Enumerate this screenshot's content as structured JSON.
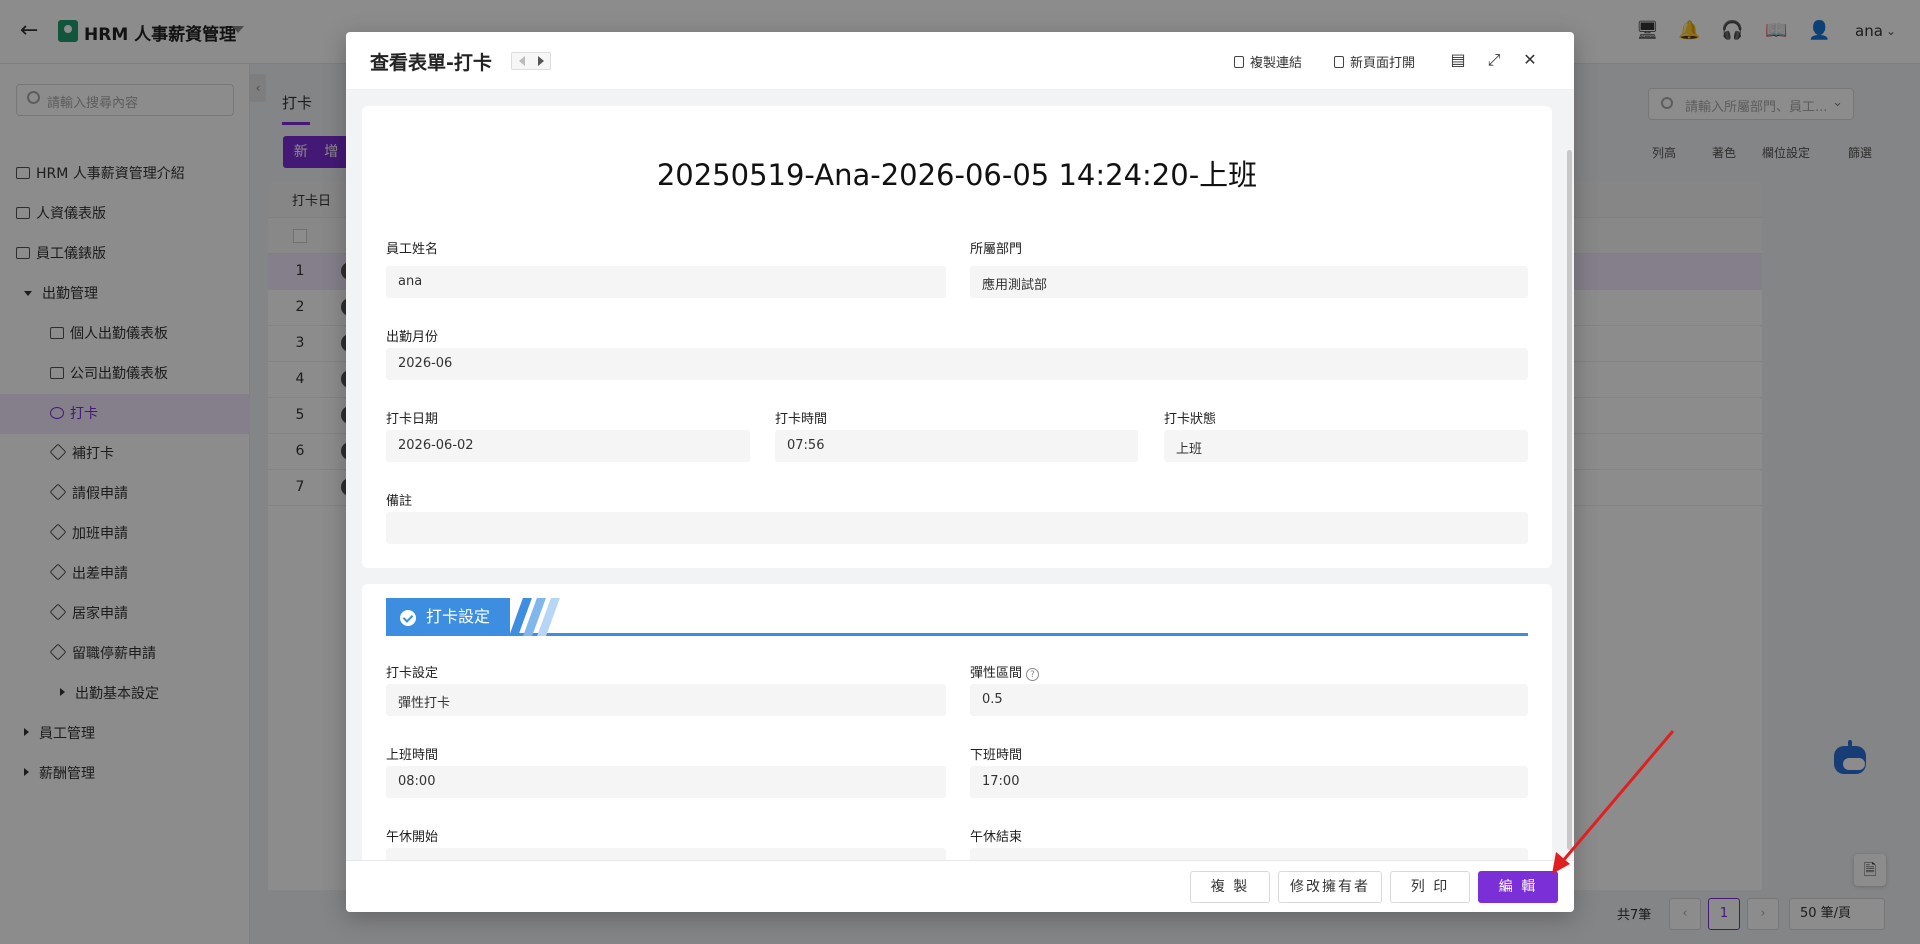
{
  "topbar": {
    "app_title": "HRM 人事薪資管理",
    "user": "ana",
    "icons": [
      "monitor-icon",
      "bell-icon",
      "headset-icon",
      "book-icon",
      "add-user-icon"
    ]
  },
  "sidebar": {
    "search_placeholder": "請輸入搜尋內容",
    "items": [
      {
        "label": "HRM 人事薪資管理介紹"
      },
      {
        "label": "人資儀表版"
      },
      {
        "label": "員工儀錶版"
      },
      {
        "label": "出勤管理"
      },
      {
        "label": "個人出勤儀表板"
      },
      {
        "label": "公司出勤儀表板"
      },
      {
        "label": "打卡"
      },
      {
        "label": "補打卡"
      },
      {
        "label": "請假申請"
      },
      {
        "label": "加班申請"
      },
      {
        "label": "出差申請"
      },
      {
        "label": "居家申請"
      },
      {
        "label": "留職停薪申請"
      },
      {
        "label": "出勤基本設定"
      },
      {
        "label": "員工管理"
      },
      {
        "label": "薪酬管理"
      }
    ]
  },
  "main": {
    "tab": "打卡",
    "add_button": "新 增",
    "search_placeholder": "請輸入所屬部門、員工...",
    "tools": [
      "列高",
      "著色",
      "欄位設定",
      "篩選"
    ],
    "group_label": "打卡日",
    "rows": [
      "1",
      "2",
      "3",
      "4",
      "5",
      "6",
      "7"
    ],
    "total": "共7筆",
    "current_page": "1",
    "page_size": "50 筆/頁"
  },
  "modal": {
    "title": "查看表單-打卡",
    "copy_link": "複製連結",
    "open_new": "新頁面打開",
    "record_title": "20250519-Ana-2026-06-05 14:24:20-上班",
    "fields": {
      "employee_name": {
        "label": "員工姓名",
        "value": "ana"
      },
      "department": {
        "label": "所屬部門",
        "value": "應用測試部"
      },
      "attendance_month": {
        "label": "出勤月份",
        "value": "2026-06"
      },
      "punch_date": {
        "label": "打卡日期",
        "value": "2026-06-02"
      },
      "punch_time": {
        "label": "打卡時間",
        "value": "07:56"
      },
      "punch_status": {
        "label": "打卡狀態",
        "value": "上班"
      },
      "remark": {
        "label": "備註",
        "value": ""
      }
    },
    "section": {
      "title": "打卡設定",
      "fields": {
        "punch_setting": {
          "label": "打卡設定",
          "value": "彈性打卡"
        },
        "flex_interval": {
          "label": "彈性區間",
          "value": "0.5"
        },
        "work_start": {
          "label": "上班時間",
          "value": "08:00"
        },
        "work_end": {
          "label": "下班時間",
          "value": "17:00"
        },
        "lunch_start": {
          "label": "午休開始",
          "value": ""
        },
        "lunch_end": {
          "label": "午休結束",
          "value": ""
        }
      }
    },
    "footer": {
      "copy": "複 製",
      "change_owner": "修改擁有者",
      "print": "列 印",
      "edit": "編 輯"
    }
  },
  "colors": {
    "accent": "#7b2fd6",
    "section_blue": "#3d8ee0",
    "annotation_arrow": "#e02020"
  }
}
